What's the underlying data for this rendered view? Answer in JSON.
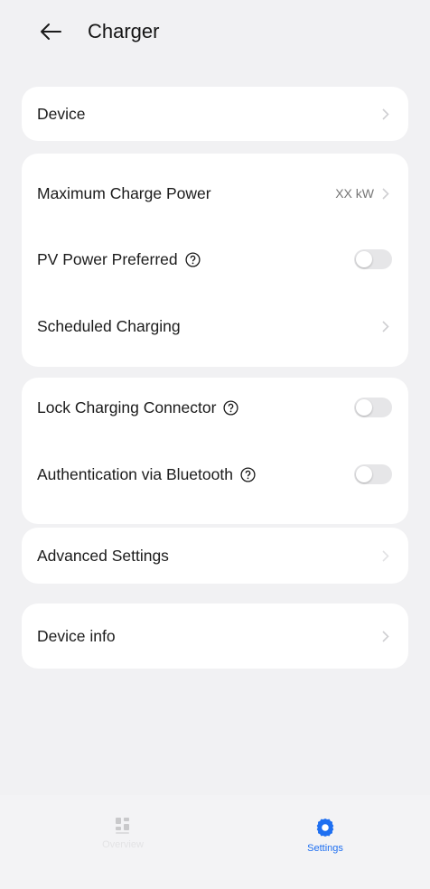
{
  "header": {
    "title": "Charger",
    "back_icon": "arrow-left-icon"
  },
  "groups": {
    "device": {
      "label": "Device"
    },
    "power": {
      "max_power": {
        "label": "Maximum Charge Power",
        "value": "XX kW"
      },
      "pv_preferred": {
        "label": "PV Power Preferred",
        "enabled": false
      },
      "scheduled": {
        "label": "Scheduled Charging"
      }
    },
    "security": {
      "lock_connector": {
        "label": "Lock Charging Connector",
        "enabled": false
      },
      "bt_auth": {
        "label": "Authentication via Bluetooth",
        "enabled": false
      }
    },
    "advanced": {
      "label": "Advanced Settings"
    },
    "info": {
      "label": "Device info"
    }
  },
  "tabbar": {
    "overview": {
      "label": "Overview",
      "icon": "grid-icon"
    },
    "settings": {
      "label": "Settings",
      "icon": "gear-icon"
    }
  },
  "colors": {
    "accent": "#1e6ff1",
    "background": "#f1f1f3",
    "card": "#ffffff"
  }
}
